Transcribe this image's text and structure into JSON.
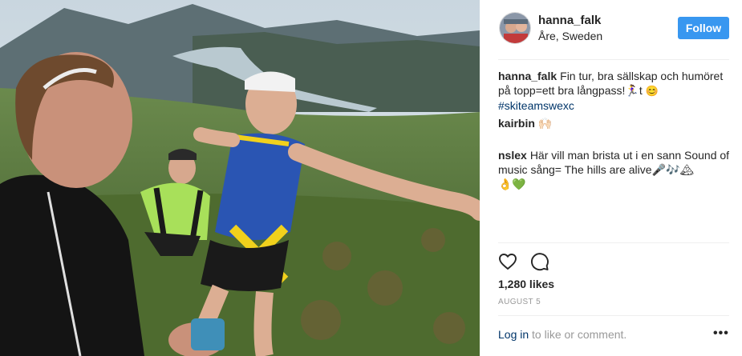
{
  "post": {
    "username": "hanna_falk",
    "location": "Åre, Sweden",
    "follow_label": "Follow",
    "caption": {
      "user": "hanna_falk",
      "text": "Fin tur, bra sällskap och humöret på topp=ett bra långpass!🏃‍♀️t ",
      "emoji": "😊",
      "hashtag": "#skiteamswexc"
    },
    "comments": [
      {
        "user": "kairbin",
        "text": "🙌🏻"
      },
      {
        "user": "nslex",
        "text": "Här vill man brista ut i en sann Sound of music sång= The hills are alive🎤🎶🏔\n👌💚"
      }
    ],
    "likes": "1,280 likes",
    "date": "AUGUST 5",
    "login_link": "Log in",
    "login_suffix": " to like or comment.",
    "more_label": "•••"
  },
  "colors": {
    "follow_button": "#3897f0",
    "link": "#003569",
    "muted": "#999999"
  },
  "icons": {
    "like": "heart-icon",
    "comment": "comment-icon",
    "more": "more-icon"
  }
}
